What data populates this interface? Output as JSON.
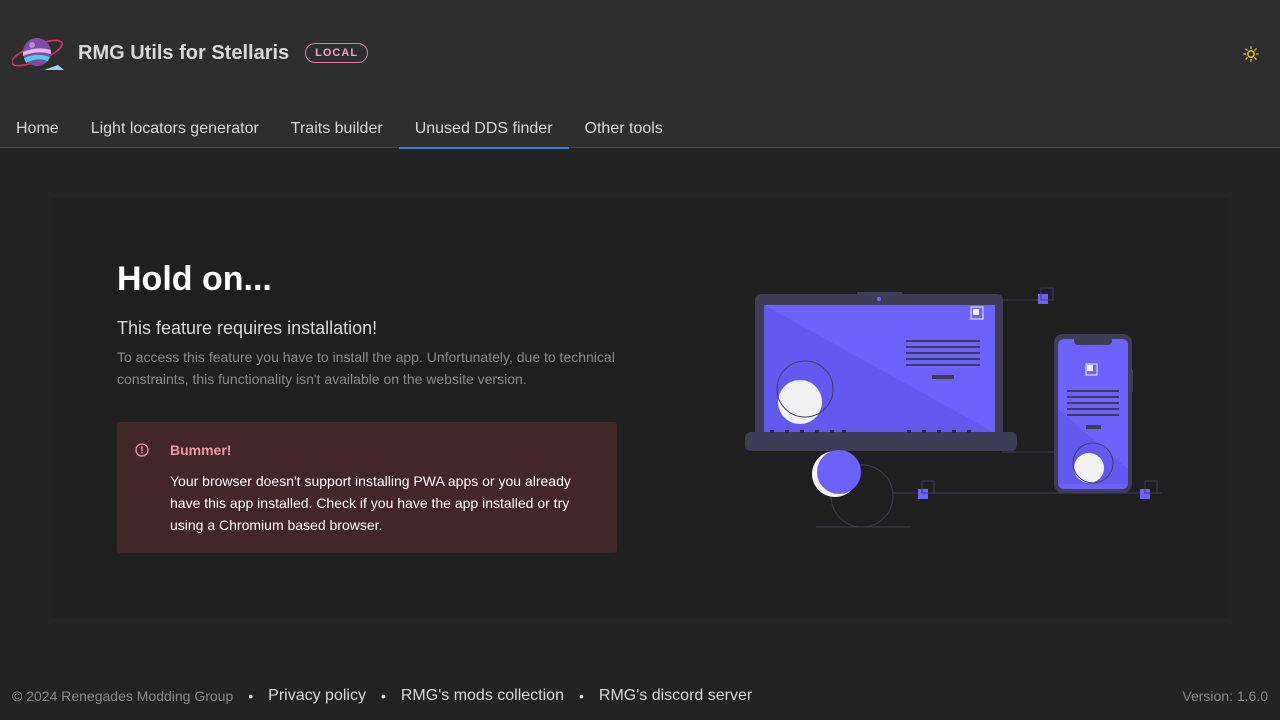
{
  "header": {
    "logo_icon": "planet-logo-icon",
    "title": "RMG Utils for Stellaris",
    "badge": "LOCAL",
    "theme_icon": "sun-icon"
  },
  "nav": {
    "tabs": [
      {
        "label": "Home",
        "active": false
      },
      {
        "label": "Light locators generator",
        "active": false
      },
      {
        "label": "Traits builder",
        "active": false
      },
      {
        "label": "Unused DDS finder",
        "active": true
      },
      {
        "label": "Other tools",
        "active": false
      }
    ]
  },
  "main": {
    "title": "Hold on...",
    "subtitle": "This feature requires installation!",
    "description": "To access this feature you have to install the app. Unfortunately, due to technical constraints, this functionality isn't available on the website version.",
    "alert": {
      "icon": "alert-circle-icon",
      "title": "Bummer!",
      "body": "Your browser doesn't support installing PWA apps or you already have this app installed. Check if you have the app installed or try using a Chromium based browser."
    },
    "illustration_icon": "devices-illustration"
  },
  "footer": {
    "copyright": "© 2024 Renegades Modding Group",
    "separator": "•",
    "links": [
      "Privacy policy",
      "RMG's mods collection",
      "RMG's discord server"
    ],
    "version": "Version: 1.6.0"
  },
  "colors": {
    "accent": "#2f86d6",
    "badge": "#e079a4",
    "alert_bg": "#432628",
    "alert_title": "#f19aa6",
    "illustration": "#6c63ff"
  }
}
